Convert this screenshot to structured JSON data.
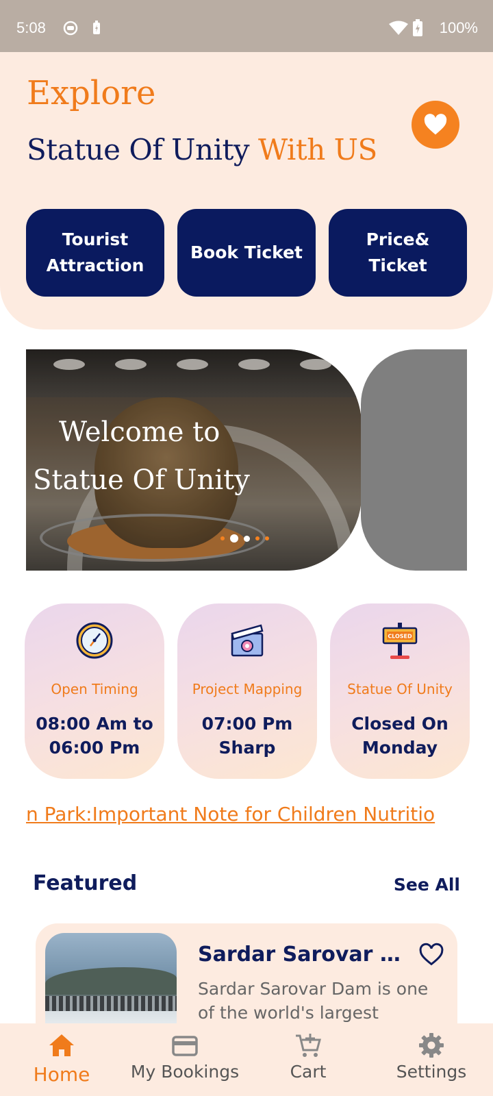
{
  "status_bar": {
    "time": "5:08",
    "battery": "100%"
  },
  "header": {
    "explore": "Explore",
    "headline_main": "Statue Of Unity ",
    "headline_accent": "With US",
    "favorite_icon": "heart-icon"
  },
  "quick_actions": [
    {
      "label": "Tourist Attraction"
    },
    {
      "label": "Book Ticket"
    },
    {
      "label": "Price& Ticket"
    }
  ],
  "carousel": {
    "line1": "Welcome to",
    "line2": "Statue Of Unity",
    "slide_count": 5,
    "active_slide": 2
  },
  "info_cards": [
    {
      "icon": "clock-icon",
      "label": "Open Timing",
      "value": "08:00 Am to 06:00 Pm"
    },
    {
      "icon": "projector-icon",
      "label": "Project Mapping",
      "value": "07:00 Pm Sharp"
    },
    {
      "icon": "closed-sign-icon",
      "label": "Statue Of Unity",
      "value": "Closed On Monday"
    }
  ],
  "marquee": {
    "text": "n Park:Important Note for Children Nutritio"
  },
  "featured": {
    "title": "Featured",
    "see_all": "See All",
    "items": [
      {
        "name": "Sardar Sarovar D...",
        "description": "Sardar Sarovar Dam is one of the world's largest"
      }
    ]
  },
  "bottom_nav": [
    {
      "label": "Home",
      "icon": "home-icon",
      "active": true
    },
    {
      "label": "My Bookings",
      "icon": "card-icon",
      "active": false
    },
    {
      "label": "Cart",
      "icon": "cart-icon",
      "active": false
    },
    {
      "label": "Settings",
      "icon": "gear-icon",
      "active": false
    }
  ],
  "colors": {
    "accent": "#f07b1b",
    "navy": "#0a1a5f",
    "header_bg": "#fdebe0"
  }
}
